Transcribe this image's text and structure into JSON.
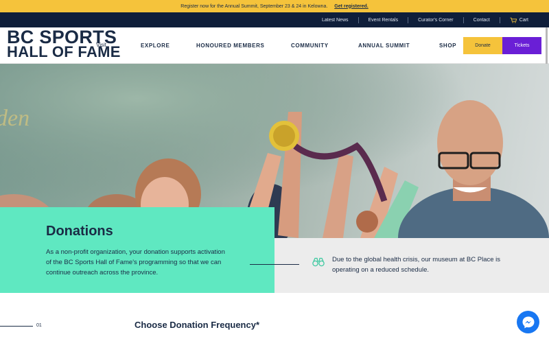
{
  "announcement": {
    "text": "Register now for the Annual Summit, September 23 & 24 in Kelowna.",
    "cta": "Get registered."
  },
  "utility_nav": {
    "items": [
      "Latest News",
      "Event Rentals",
      "Curator's Corner",
      "Contact"
    ],
    "cart": "Cart"
  },
  "header": {
    "logo_line1": "BC SPORTS",
    "logo_line2": "HALL OF FAME",
    "visit": "Visit",
    "nav": [
      "EXPLORE",
      "HONOURED MEMBERS",
      "COMMUNITY",
      "ANNUAL SUMMIT",
      "SHOP"
    ],
    "donate": "Donate",
    "tickets": "Tickets"
  },
  "donations": {
    "title": "Donations",
    "body": "As a non-profit organization, your donation supports activation of the BC Sports Hall of Fame's programming so that we can continue outreach across the province."
  },
  "notice": {
    "text": "Due to the global health crisis, our museum at BC Place is operating on a reduced schedule."
  },
  "step": {
    "number": "01",
    "title": "Choose Donation Frequency*"
  },
  "colors": {
    "announce": "#f5c33b",
    "navy": "#0f1e3a",
    "text": "#1a2b45",
    "mint": "#5fe8c1",
    "purple": "#6a1fd6",
    "messenger": "#1877f2"
  },
  "icons": [
    "cart-icon",
    "binoculars-icon",
    "messenger-icon"
  ]
}
